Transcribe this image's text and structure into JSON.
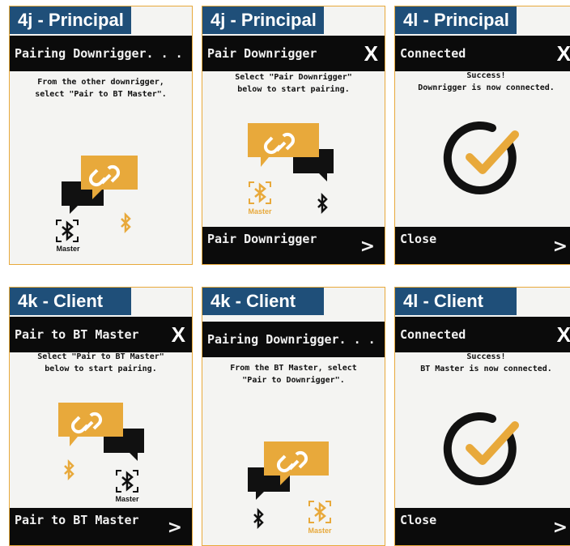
{
  "panels": [
    {
      "tag": "4j - Principal",
      "header": "Pairing Downrigger. . .",
      "message_lines": [
        "From the other downrigger,",
        "select \"Pair to BT Master\"."
      ],
      "master_label": "Master"
    },
    {
      "tag": "4j - Principal",
      "header": "Pair Downrigger",
      "close": "X",
      "message_lines": [
        "Select \"Pair Downrigger\"",
        "below to start pairing."
      ],
      "master_label": "Master",
      "footer": "Pair Downrigger",
      "chevron": ">"
    },
    {
      "tag": "4l - Principal",
      "header": "Connected",
      "close": "X",
      "message_lines": [
        "Success!",
        "Downrigger is now connected."
      ],
      "footer": "Close",
      "chevron": ">"
    },
    {
      "tag": "4k - Client",
      "header": "Pair to BT Master",
      "close": "X",
      "message_lines": [
        "Select \"Pair to BT Master\"",
        "below to start pairing."
      ],
      "master_label": "Master",
      "footer": "Pair to BT Master",
      "chevron": ">"
    },
    {
      "tag": "4k - Client",
      "header": "Pairing Downrigger. . .",
      "message_lines": [
        "From the BT Master, select",
        "\"Pair to Downrigger\"."
      ],
      "master_label": "Master"
    },
    {
      "tag": "4l - Client",
      "header": "Connected",
      "close": "X",
      "message_lines": [
        "Success!",
        "BT Master is now connected."
      ],
      "footer": "Close",
      "chevron": ">"
    }
  ],
  "colors": {
    "accent": "#e8a93b",
    "tag_bg": "#1f4f79",
    "bar_bg": "#0b0b0b",
    "screen_bg": "#f4f4f2"
  }
}
